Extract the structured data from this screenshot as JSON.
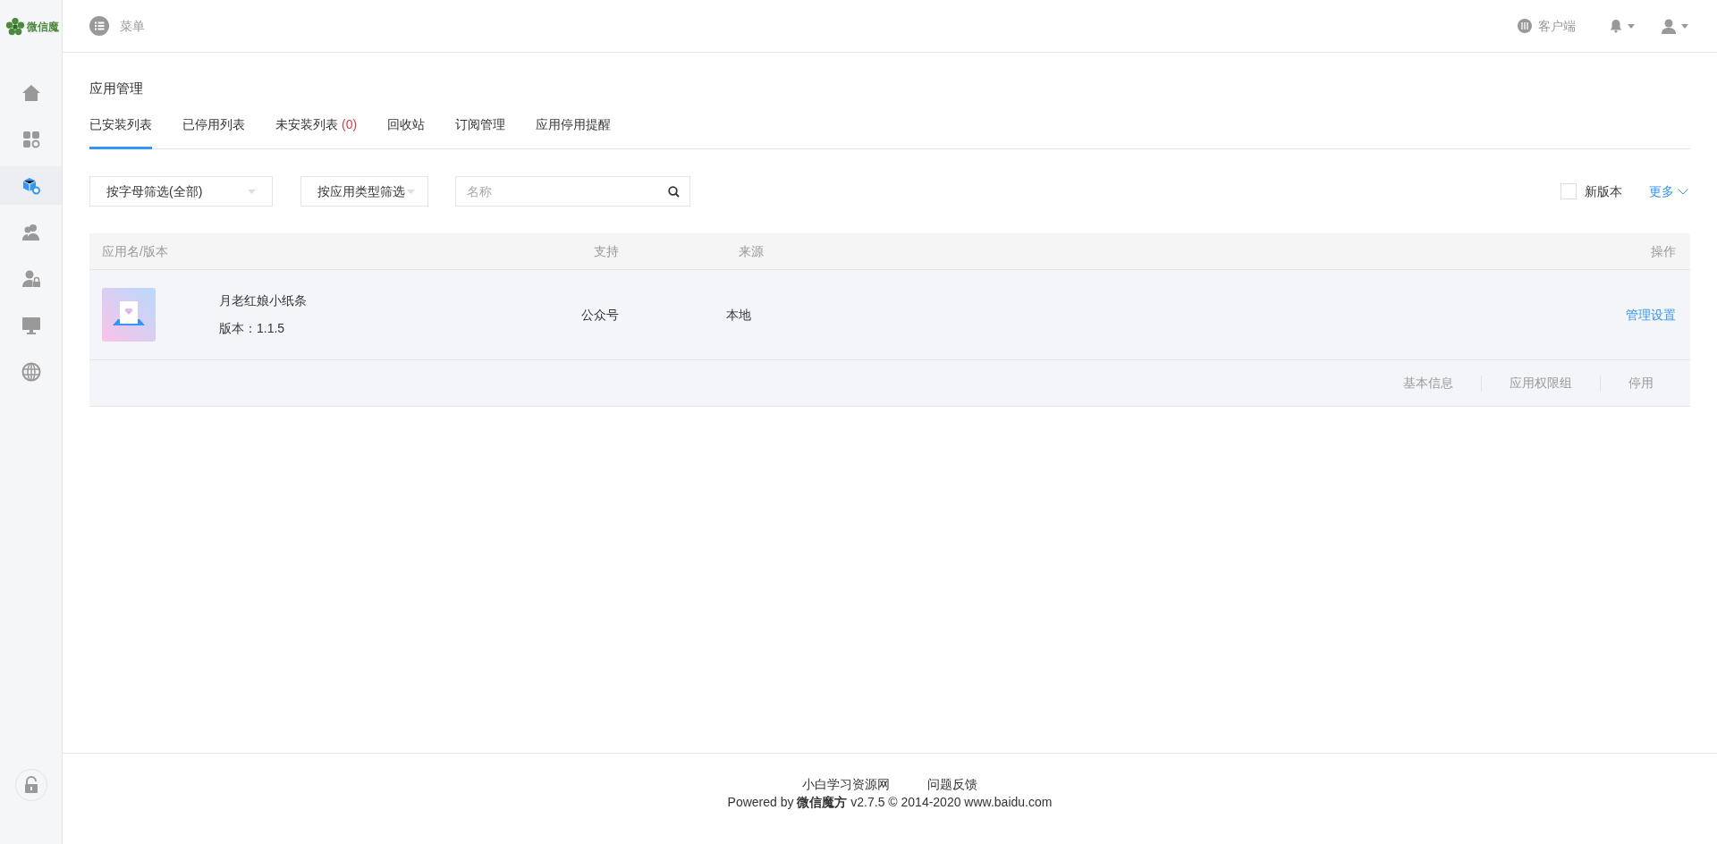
{
  "sidebar": {
    "logo_text": "微信魔",
    "items": [
      {
        "selected": false
      },
      {
        "selected": false
      },
      {
        "selected": true
      },
      {
        "selected": false
      },
      {
        "selected": false
      },
      {
        "selected": false
      },
      {
        "selected": false
      }
    ]
  },
  "topbar": {
    "menu_label": "菜单",
    "client_label": "客户端"
  },
  "page_title": "应用管理",
  "tabs": [
    {
      "label": "已安装列表",
      "selected": true
    },
    {
      "label": "已停用列表",
      "selected": false
    },
    {
      "label": "未安装列表",
      "count": "(0)",
      "selected": false
    },
    {
      "label": "回收站",
      "selected": false
    },
    {
      "label": "订阅管理",
      "selected": false
    },
    {
      "label": "应用停用提醒",
      "selected": false
    }
  ],
  "filters": {
    "letter_filter": "按字母筛选(全部)",
    "type_filter": "按应用类型筛选",
    "search": {
      "placeholder": "名称"
    },
    "new_version": {
      "label": "新版本",
      "checked": false
    },
    "more": "更多"
  },
  "table": {
    "columns": [
      "应用名/版本",
      "支持",
      "来源",
      "操作"
    ],
    "rows": [
      {
        "name": "月老红娘小纸条",
        "version": "版本：1.1.5",
        "support": "公众号",
        "source": "本地",
        "action": "管理设置",
        "sub_actions": [
          "基本信息",
          "应用权限组",
          "停用"
        ]
      }
    ]
  },
  "footer": {
    "links": [
      "小白学习资源网",
      "问题反馈"
    ],
    "copyright": "Powered by **微信魔方** v2.7.5 © 2014-2020 www.baidu.com"
  }
}
